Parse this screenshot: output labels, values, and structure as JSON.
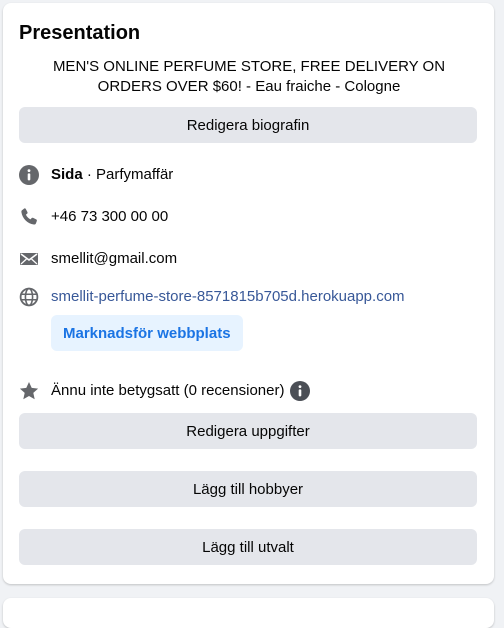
{
  "section": {
    "title": "Presentation",
    "bio": "MEN'S ONLINE PERFUME STORE, FREE DELIVERY ON ORDERS OVER $60! - Eau fraiche - Cologne"
  },
  "buttons": {
    "edit_bio": "Redigera biografin",
    "edit_details": "Redigera uppgifter",
    "add_hobbies": "Lägg till hobbyer",
    "add_featured": "Lägg till utvalt",
    "promote_website": "Marknadsför webbplats"
  },
  "details": {
    "page_label": "Sida",
    "page_separator": " · ",
    "page_category": "Parfymaffär",
    "phone": "+46 73 300 00 00",
    "email": "smellit@gmail.com",
    "website": "smellit-perfume-store-8571815b705d.herokuapp.com",
    "rating": "Ännu inte betygsatt (0 recensioner)"
  },
  "icons": {
    "page": "info-icon",
    "phone": "phone-icon",
    "email": "envelope-icon",
    "website": "globe-icon",
    "rating": "star-icon",
    "rating_info": "info-icon"
  },
  "colors": {
    "link": "#385898",
    "promo_text": "#1b74e4",
    "promo_bg": "#e7f3ff",
    "button_bg": "#e4e6eb",
    "icon": "#65676b"
  }
}
